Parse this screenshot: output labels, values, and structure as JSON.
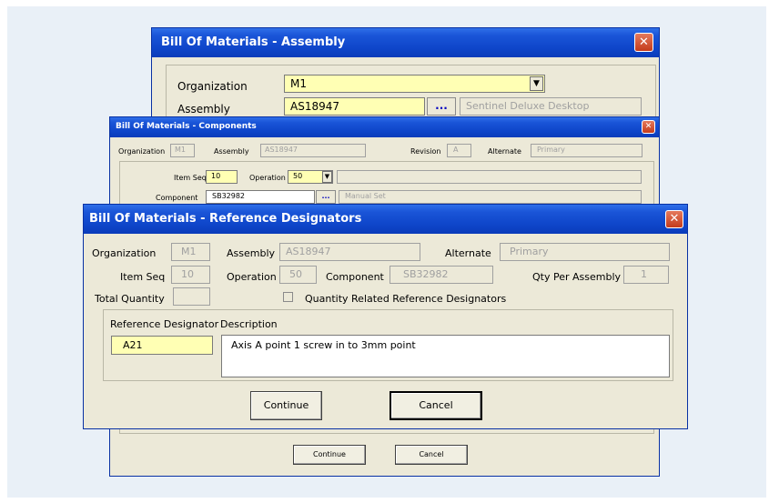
{
  "assembly_window": {
    "title": "Bill Of Materials - Assembly",
    "organization_label": "Organization",
    "organization_value": "M1",
    "assembly_label": "Assembly",
    "assembly_value": "AS18947",
    "assembly_desc": "Sentinel Deluxe Desktop",
    "lookup_label": "..."
  },
  "components_window": {
    "title": "Bill Of Materials - Components",
    "organization_label": "Organization",
    "organization_value": "M1",
    "assembly_label": "Assembly",
    "assembly_value": "AS18947",
    "revision_label": "Revision",
    "revision_value": "A",
    "alternate_label": "Alternate",
    "alternate_value": "Primary",
    "item_seq_label": "Item Seq",
    "item_seq_value": "10",
    "operation_label": "Operation",
    "operation_value": "50",
    "component_label": "Component",
    "component_value": "SB32982",
    "component_desc": "Manual Set",
    "lookup_label": "...",
    "continue_label": "Continue",
    "cancel_label": "Cancel"
  },
  "refdes_window": {
    "title": "Bill Of Materials - Reference Designators",
    "organization_label": "Organization",
    "organization_value": "M1",
    "assembly_label": "Assembly",
    "assembly_value": "AS18947",
    "alternate_label": "Alternate",
    "alternate_value": "Primary",
    "item_seq_label": "Item Seq",
    "item_seq_value": "10",
    "operation_label": "Operation",
    "operation_value": "50",
    "component_label": "Component",
    "component_value": "SB32982",
    "qty_per_assembly_label": "Qty Per Assembly",
    "qty_per_assembly_value": "1",
    "total_quantity_label": "Total Quantity",
    "total_quantity_value": "",
    "qty_related_label": "Quantity Related Reference Designators",
    "ref_designator_header": "Reference Designator",
    "description_header": "Description",
    "ref_designator_value": "A21",
    "description_value": "Axis A point 1 screw in to 3mm point",
    "continue_label": "Continue",
    "cancel_label": "Cancel"
  },
  "icons": {
    "close": "close-icon",
    "dropdown": "chevron-down-icon"
  },
  "colors": {
    "title_blue": "#0a3cba",
    "required_yellow": "#ffffb4",
    "dialog_face": "#ece9d8",
    "close_red": "#c43b1b"
  }
}
